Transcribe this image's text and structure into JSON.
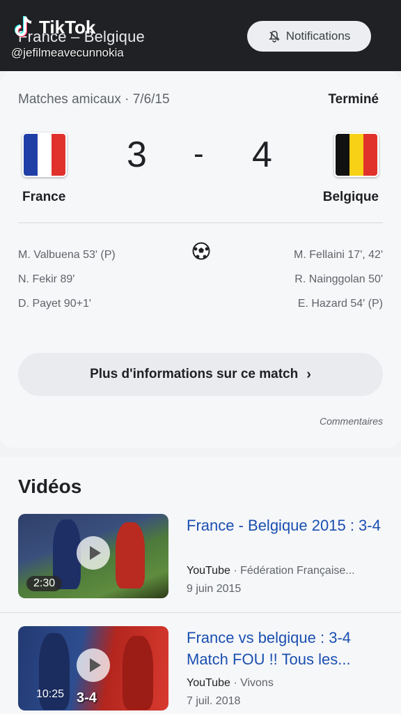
{
  "header": {
    "title": "France – Belgique",
    "notifications_label": "Notifications",
    "watermark_brand": "TikTok",
    "watermark_handle": "@jefilmeavecunnokia"
  },
  "match": {
    "competition_date": "Matches amicaux · 7/6/15",
    "status": "Terminé",
    "home": {
      "name": "France",
      "score": "3",
      "flag_colors": [
        "#1f3fa6",
        "#ffffff",
        "#e0322b"
      ]
    },
    "away": {
      "name": "Belgique",
      "score": "4",
      "flag_colors": [
        "#111111",
        "#f6d116",
        "#e0322b"
      ]
    },
    "separator": "-",
    "home_scorers": [
      "M. Valbuena 53' (P)",
      "N. Fekir 89'",
      "D. Payet 90+1'"
    ],
    "away_scorers": [
      "M. Fellaini 17', 42'",
      "R. Nainggolan 50'",
      "E. Hazard 54' (P)"
    ],
    "more_info_label": "Plus d'informations sur ce match",
    "comments_label": "Commentaires"
  },
  "videos": {
    "heading": "Vidéos",
    "items": [
      {
        "title": "France - Belgique 2015 : 3-4",
        "source": "YouTube",
        "channel": "Fédération Française...",
        "date": "9 juin 2015",
        "duration": "2:30"
      },
      {
        "title": "France vs belgique : 3-4 Match FOU !! Tous les...",
        "source": "YouTube",
        "channel": "Vivons",
        "date": "7 juil. 2018",
        "duration": "10:25",
        "overlay_text": "3-4"
      }
    ]
  },
  "colors": {
    "link": "#1a4fb0",
    "topbar": "#202124"
  }
}
